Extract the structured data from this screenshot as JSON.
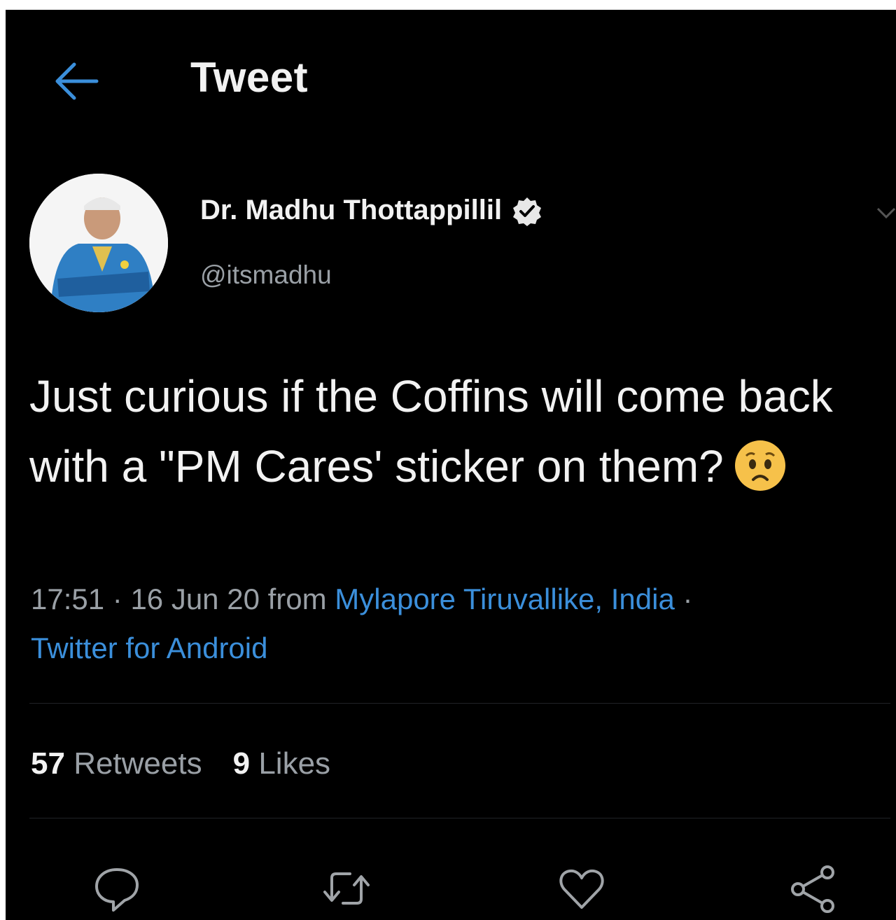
{
  "header": {
    "title": "Tweet",
    "back_icon": "back-arrow-icon",
    "accent_color": "#3b8fdb"
  },
  "author": {
    "name": "Dr. Madhu Thottappillil",
    "handle": "@itsmadhu",
    "verified": true,
    "verified_icon": "verified-badge-icon"
  },
  "tweet": {
    "text": "Just curious if the Coffins will come back with a \"PM Cares' sticker on them?",
    "emoji": "worried-face-icon",
    "time": "17:51",
    "date": "16 Jun 20",
    "from_label": "from",
    "location": "Mylapore Tiruvallike, India",
    "source": "Twitter for Android"
  },
  "stats": {
    "retweets_count": "57",
    "retweets_label": "Retweets",
    "likes_count": "9",
    "likes_label": "Likes"
  },
  "actions": [
    "reply-icon",
    "retweet-icon",
    "like-icon",
    "share-icon"
  ]
}
